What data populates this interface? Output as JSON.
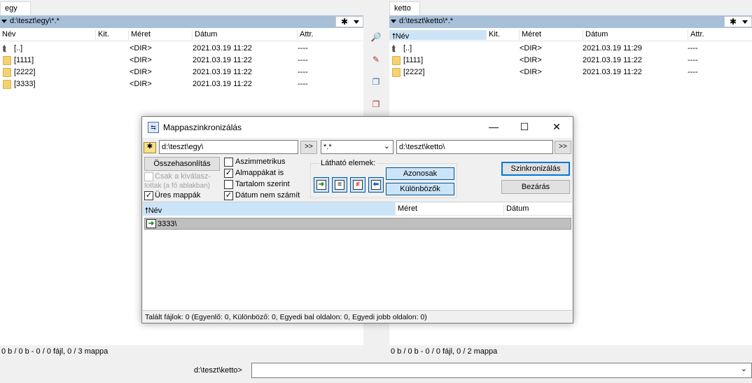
{
  "left_panel": {
    "tab": "egy",
    "path": "d:\\teszt\\egy\\*.*",
    "filter_icon": "asterisk",
    "columns": [
      "Név",
      "Kit.",
      "Méret",
      "Dátum",
      "Attr."
    ],
    "rows": [
      {
        "icon": "up-icon",
        "name": "[..]",
        "size": "<DIR>",
        "date": "2021.03.19 11:22",
        "attr": "----"
      },
      {
        "icon": "folder-icon",
        "name": "[1111]",
        "size": "<DIR>",
        "date": "2021.03.19 11:22",
        "attr": "----"
      },
      {
        "icon": "folder-icon",
        "name": "[2222]",
        "size": "<DIR>",
        "date": "2021.03.19 11:22",
        "attr": "----"
      },
      {
        "icon": "folder-icon",
        "name": "[3333]",
        "size": "<DIR>",
        "date": "2021.03.19 11:22",
        "attr": "----"
      }
    ],
    "status": "0 b / 0 b - 0 / 0 fájl, 0 / 3 mappa"
  },
  "right_panel": {
    "tab": "ketto",
    "path": "d:\\teszt\\ketto\\*.*",
    "filter_icon": "asterisk",
    "columns": [
      "Név",
      "Kit.",
      "Méret",
      "Dátum",
      "Attr."
    ],
    "rows": [
      {
        "icon": "up-icon",
        "name": "[..]",
        "size": "<DIR>",
        "date": "2021.03.19 11:29",
        "attr": "----"
      },
      {
        "icon": "folder-icon",
        "name": "[1111]",
        "size": "<DIR>",
        "date": "2021.03.19 11:22",
        "attr": "----"
      },
      {
        "icon": "folder-icon",
        "name": "[2222]",
        "size": "<DIR>",
        "date": "2021.03.19 11:22",
        "attr": "----"
      }
    ],
    "status": "0 b / 0 b - 0 / 0 fájl, 0 / 2 mappa"
  },
  "command_line": {
    "label": "d:\\teszt\\ketto>",
    "value": ""
  },
  "dialog": {
    "title": "Mappaszinkronizálás",
    "left_path": "d:\\teszt\\egy\\",
    "right_path": "d:\\teszt\\ketto\\",
    "mask": "*.*",
    "browse_label": ">>",
    "compare_button": "Összehasonlítás",
    "only_selected_label": "Csak a kiválasz-",
    "only_selected_label_2": "tottak (a fő ablakban)",
    "empty_folders_label": "Üres mappák",
    "asymmetric_label": "Aszimmetrikus",
    "subfolders_label": "Almappákat is",
    "by_content_label": "Tartalom szerint",
    "ignore_date_label": "Dátum nem számít",
    "checks": {
      "only_selected": false,
      "empty_folders": true,
      "asymmetric": false,
      "subfolders": true,
      "by_content": false,
      "ignore_date": true
    },
    "visible_items_label": "Látható elemek:",
    "identical_button": "Azonosak",
    "different_button": "Különbözők",
    "sync_button": "Szinkronizálás",
    "close_button": "Bezárás",
    "list_columns": [
      "Név",
      "Méret",
      "Dátum"
    ],
    "list_items": [
      {
        "name": "3333\\"
      }
    ],
    "status": "Talált fájlok: 0  (Egyenlő: 0, Különböző: 0, Egyedi bal oldalon: 0, Egyedi jobb oldalon: 0)"
  }
}
